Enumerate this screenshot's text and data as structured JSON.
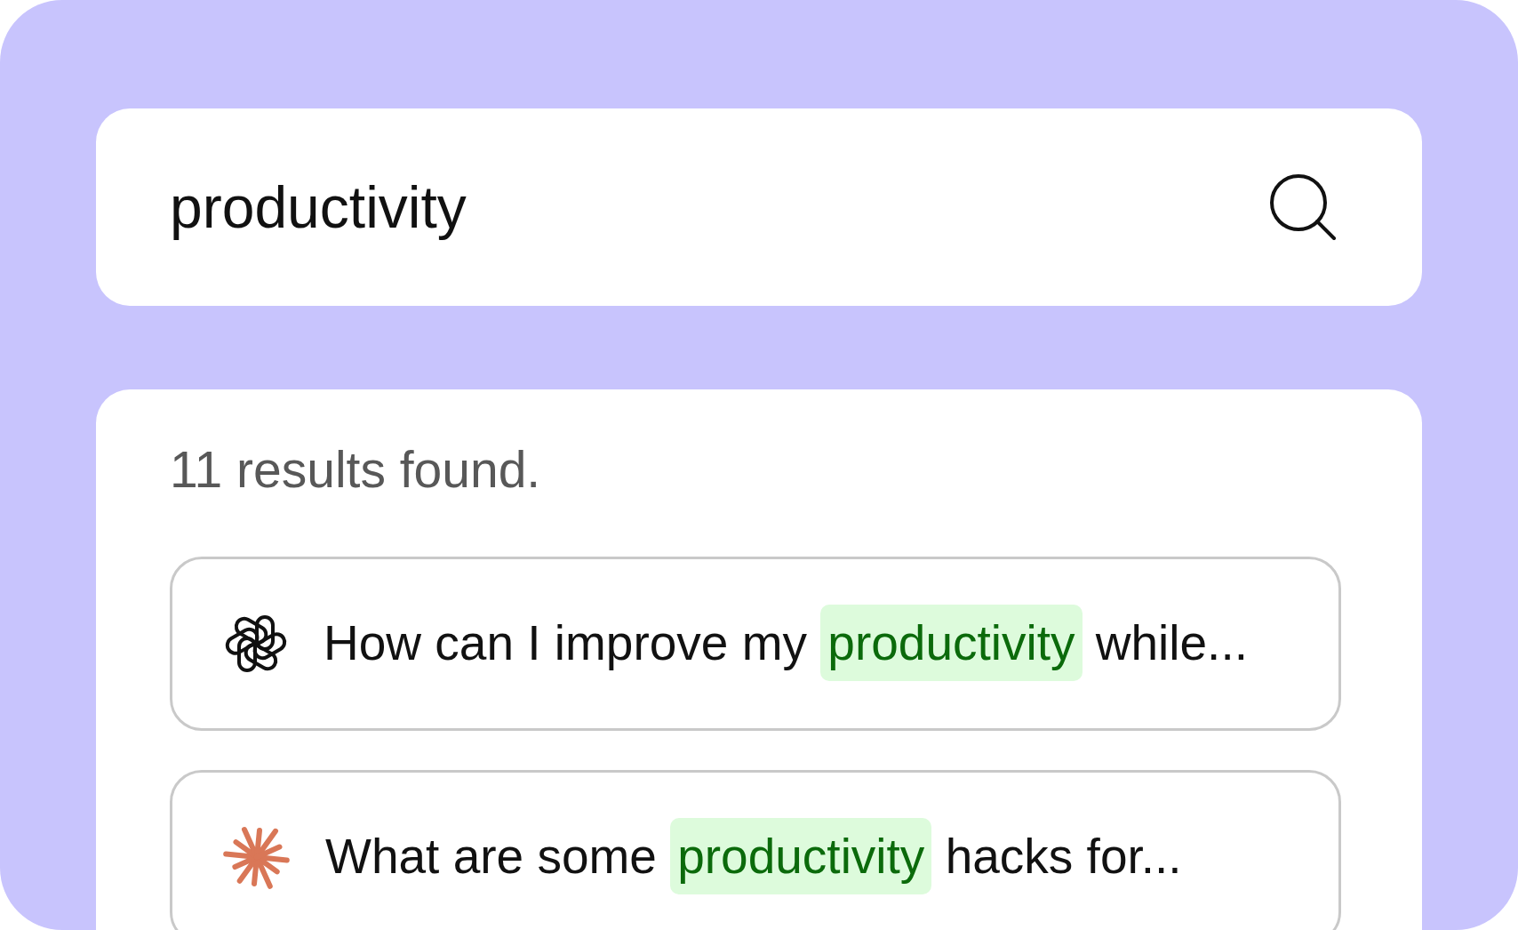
{
  "search": {
    "value": "productivity"
  },
  "results_summary": "11 results found.",
  "results": [
    {
      "kind": "openai",
      "segments": [
        {
          "text": "How can I improve my ",
          "highlighted": false
        },
        {
          "text": "productivity",
          "highlighted": true
        },
        {
          "text": " while...",
          "highlighted": false
        }
      ]
    },
    {
      "kind": "claude",
      "segments": [
        {
          "text": "What are some ",
          "highlighted": false
        },
        {
          "text": "productivity",
          "highlighted": true
        },
        {
          "text": " hacks for...",
          "highlighted": false
        }
      ]
    }
  ]
}
